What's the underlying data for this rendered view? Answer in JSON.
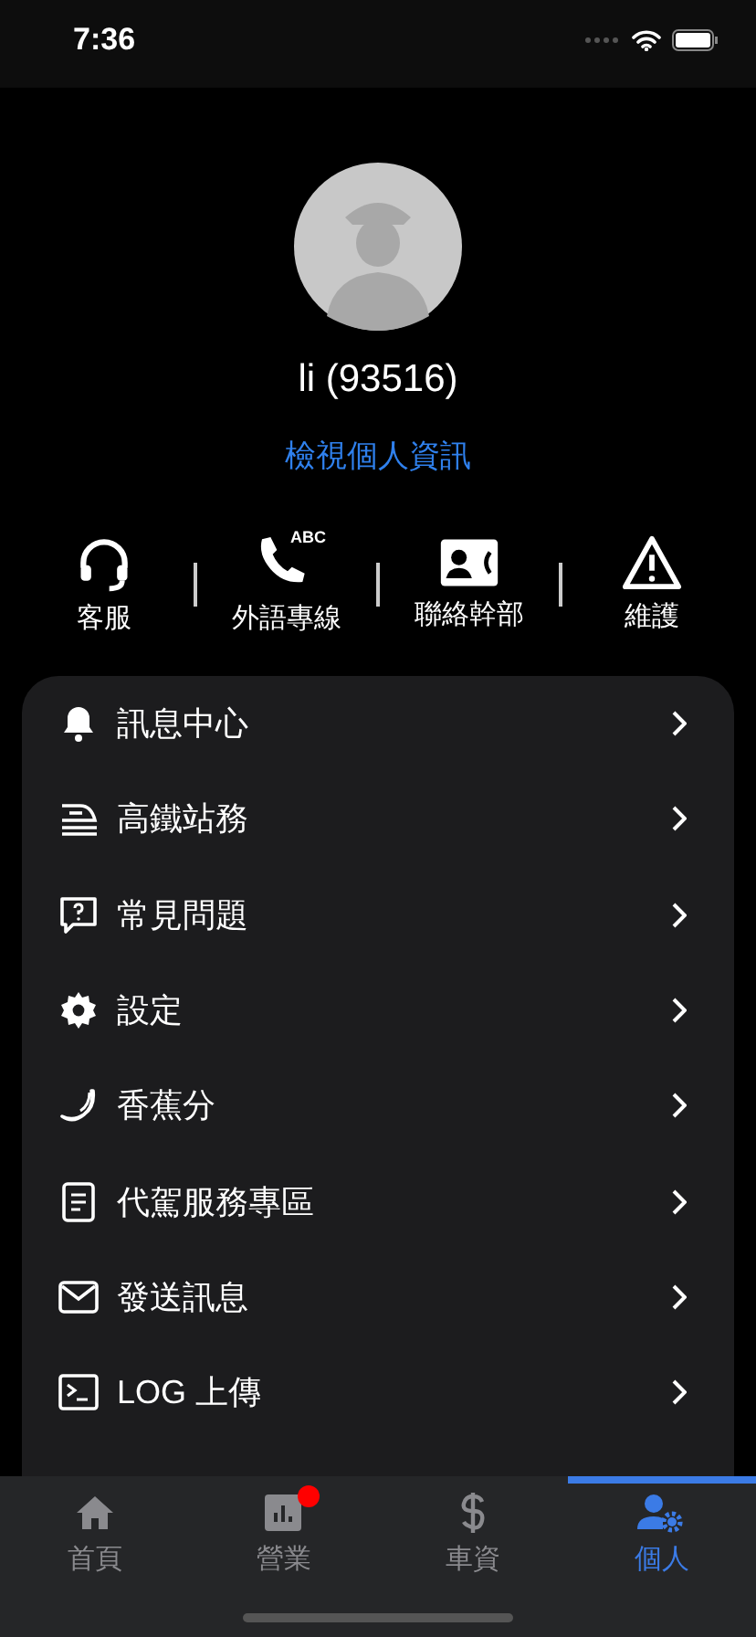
{
  "status_bar": {
    "time": "7:36"
  },
  "profile": {
    "name": "li (93516)",
    "link": "檢視個人資訊"
  },
  "quick_actions": [
    {
      "kind": "headset",
      "label": "客服"
    },
    {
      "kind": "phone",
      "label": "外語專線",
      "icon_text": "ABC"
    },
    {
      "kind": "contact",
      "label": "聯絡幹部"
    },
    {
      "kind": "warning",
      "label": "維護"
    }
  ],
  "menu": [
    {
      "kind": "bell",
      "label": "訊息中心"
    },
    {
      "kind": "train",
      "label": "高鐵站務"
    },
    {
      "kind": "faq",
      "label": "常見問題"
    },
    {
      "kind": "gear",
      "label": "設定"
    },
    {
      "kind": "banana",
      "label": "香蕉分"
    },
    {
      "kind": "document",
      "label": "代駕服務專區"
    },
    {
      "kind": "mail",
      "label": "發送訊息"
    },
    {
      "kind": "terminal",
      "label": "LOG 上傳"
    }
  ],
  "tabs": [
    {
      "kind": "home",
      "label": "首頁",
      "selected": false,
      "badge": false
    },
    {
      "kind": "chart",
      "label": "營業",
      "selected": false,
      "badge": true
    },
    {
      "kind": "dollar",
      "label": "車資",
      "selected": false,
      "badge": false
    },
    {
      "kind": "person",
      "label": "個人",
      "selected": true,
      "badge": false
    }
  ]
}
